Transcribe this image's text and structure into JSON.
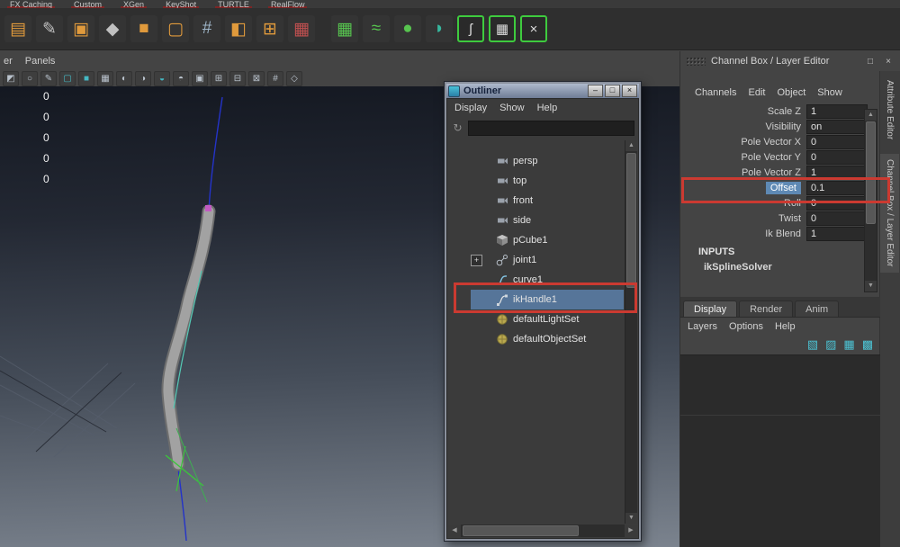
{
  "shelf_tabs": [
    "FX Caching",
    "Custom",
    "XGen",
    "KeyShot",
    "TURTLE",
    "RealFlow"
  ],
  "shelf_icons": [
    {
      "name": "poly-mesh-icon",
      "glyph": "▤"
    },
    {
      "name": "pencil-tool-icon",
      "glyph": "✎"
    },
    {
      "name": "cube-stack-icon",
      "glyph": "▣"
    },
    {
      "name": "component-points-icon",
      "glyph": "◆"
    },
    {
      "name": "poly-cube-icon",
      "glyph": "■"
    },
    {
      "name": "selection-box-icon",
      "glyph": "▢"
    },
    {
      "name": "lattice-icon",
      "glyph": "#"
    },
    {
      "name": "extrude-icon",
      "glyph": "◧"
    },
    {
      "name": "snap-grid-icon",
      "glyph": "⊞"
    },
    {
      "name": "multi-component-icon",
      "glyph": "▦"
    },
    {
      "name": "quad-draw-icon",
      "glyph": "▦"
    },
    {
      "name": "sculpt-wave-icon",
      "glyph": "≈"
    },
    {
      "name": "sculpt-blob-icon",
      "glyph": "●"
    },
    {
      "name": "smooth-mesh-icon",
      "glyph": "◗"
    },
    {
      "name": "spline-ik-bracket-icon",
      "glyph": "ʃ"
    },
    {
      "name": "grid-bracket-icon",
      "glyph": "▦"
    },
    {
      "name": "cross-bracket-icon",
      "glyph": "×"
    }
  ],
  "panel_menus": [
    "er",
    "Panels"
  ],
  "viewport_toolbar_icons": [
    {
      "name": "select-icon",
      "glyph": "◩"
    },
    {
      "name": "lasso-icon",
      "glyph": "○"
    },
    {
      "name": "paint-select-icon",
      "glyph": "✎"
    },
    {
      "name": "wireframe-icon",
      "glyph": "▢"
    },
    {
      "name": "shaded-icon",
      "glyph": "■"
    },
    {
      "name": "textured-icon",
      "glyph": "▦"
    },
    {
      "name": "lighting-icon",
      "glyph": "◐"
    },
    {
      "name": "shadows-icon",
      "glyph": "◑"
    },
    {
      "name": "screen-ao-icon",
      "glyph": "◒"
    },
    {
      "name": "xray-icon",
      "glyph": "◓"
    },
    {
      "name": "camera-icon",
      "glyph": "▣"
    },
    {
      "name": "resolution-gate-icon",
      "glyph": "⊞"
    },
    {
      "name": "film-gate-icon",
      "glyph": "⊟"
    },
    {
      "name": "safe-action-icon",
      "glyph": "⊠"
    },
    {
      "name": "grid-icon",
      "glyph": "#"
    },
    {
      "name": "isolate-select-icon",
      "glyph": "◇"
    }
  ],
  "viewport_hud": [
    "0",
    "0",
    "0",
    "0",
    "0"
  ],
  "outliner": {
    "title": "Outliner",
    "window_buttons": {
      "minimize": "–",
      "maximize": "□",
      "close": "×"
    },
    "menus": [
      "Display",
      "Show",
      "Help"
    ],
    "search_value": "",
    "search_icon_glyph": "↻",
    "expander_plus": "+",
    "items": [
      {
        "label": "persp",
        "icon": "camera-icon"
      },
      {
        "label": "top",
        "icon": "camera-icon"
      },
      {
        "label": "front",
        "icon": "camera-icon"
      },
      {
        "label": "side",
        "icon": "camera-icon"
      },
      {
        "label": "pCube1",
        "icon": "polycube-icon"
      },
      {
        "label": "joint1",
        "icon": "joint-icon",
        "expandable": true
      },
      {
        "label": "curve1",
        "icon": "curve-icon"
      },
      {
        "label": "ikHandle1",
        "icon": "ikhandle-icon",
        "selected": true
      },
      {
        "label": "defaultLightSet",
        "icon": "set-icon"
      },
      {
        "label": "defaultObjectSet",
        "icon": "set-icon"
      }
    ]
  },
  "scrollbars": {
    "up": "▲",
    "down": "▼",
    "left": "◀",
    "right": "▶"
  },
  "channel_box": {
    "header_title": "Channel Box / Layer Editor",
    "header_icons": [
      {
        "name": "dock-icon",
        "glyph": "□"
      },
      {
        "name": "close-icon",
        "glyph": "×"
      }
    ],
    "menus": [
      "Channels",
      "Edit",
      "Object",
      "Show"
    ],
    "attributes": [
      {
        "label": "Scale Z",
        "value": "1"
      },
      {
        "label": "Visibility",
        "value": "on"
      },
      {
        "label": "Pole Vector X",
        "value": "0"
      },
      {
        "label": "Pole Vector Y",
        "value": "0"
      },
      {
        "label": "Pole Vector Z",
        "value": "1"
      },
      {
        "label": "Offset",
        "value": "0.1",
        "selected": true
      },
      {
        "label": "Roll",
        "value": "0"
      },
      {
        "label": "Twist",
        "value": "0"
      },
      {
        "label": "Ik Blend",
        "value": "1"
      }
    ],
    "inputs_heading": "INPUTS",
    "inputs_node": "ikSplineSolver"
  },
  "layer_editor": {
    "tabs": [
      "Display",
      "Render",
      "Anim"
    ],
    "active_tab": "Display",
    "menus": [
      "Layers",
      "Options",
      "Help"
    ],
    "icons": [
      {
        "name": "add-empty-layer-icon",
        "glyph": "▧"
      },
      {
        "name": "add-layer-selected-icon",
        "glyph": "▨"
      },
      {
        "name": "add-render-layer-icon",
        "glyph": "▦"
      },
      {
        "name": "add-render-layer-selected-icon",
        "glyph": "▩"
      }
    ]
  },
  "side_tabs": [
    "Attribute Editor",
    "Channel Box / Layer Editor"
  ],
  "colors": {
    "annotation_red": "#cb3a31",
    "selection_blue": "#567599",
    "channel_selected_blue": "#5e89b4",
    "viewport_top": "#141821",
    "viewport_bottom": "#7b838e"
  }
}
